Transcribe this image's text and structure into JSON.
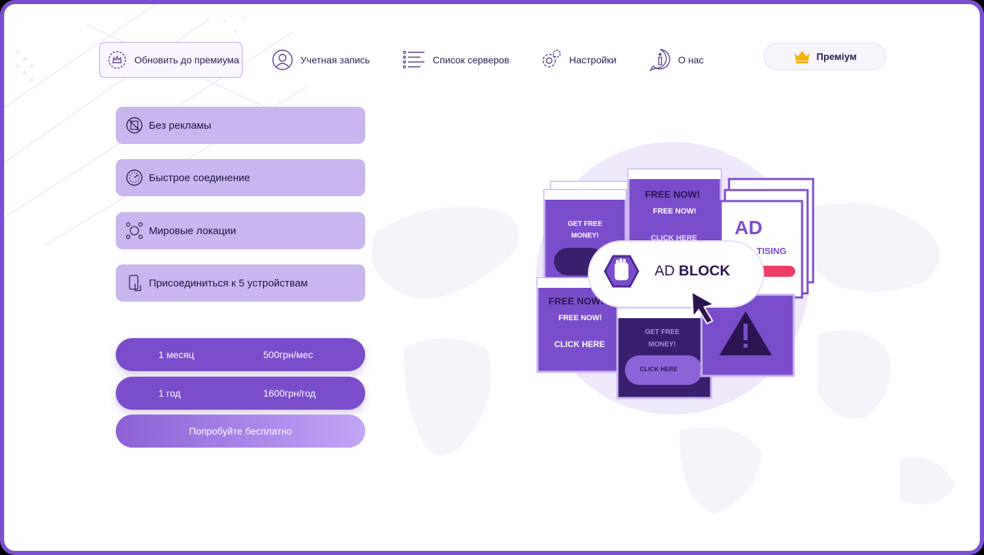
{
  "nav": {
    "upgrade": "Обновить до премиума",
    "account": "Учетная запись",
    "servers": "Список серверов",
    "settings": "Настройки",
    "about": "О нас",
    "premium": "Преміум"
  },
  "features": [
    {
      "label": "Без рекламы",
      "icon": "no-ads-icon"
    },
    {
      "label": "Быстрое соединение",
      "icon": "speedometer-icon"
    },
    {
      "label": "Мировые локации",
      "icon": "globe-locations-icon"
    },
    {
      "label": "Присоединиться к 5 устройствам",
      "icon": "devices-icon"
    }
  ],
  "plans": [
    {
      "period": "1 месяц",
      "price": "500грн/мес"
    },
    {
      "period": "1 год",
      "price": "1600грн/год"
    }
  ],
  "trial": "Попробуйте бесплатно",
  "illustration": {
    "free_now": "FREE NOW!",
    "free_now_sub": "FREE NOW!",
    "click_here": "CLICK HERE",
    "get_free": "GET FREE",
    "money": "MONEY!",
    "ad": "AD",
    "tising": "TISING",
    "badge_ad": "AD",
    "badge_block": "BLOCK",
    "click_here_small": "CLICK HERE"
  },
  "colors": {
    "accent": "#7b4dcc",
    "feature_bg": "#c9b6ef",
    "border": "#7b4fd0",
    "crown": "#f5b301"
  }
}
